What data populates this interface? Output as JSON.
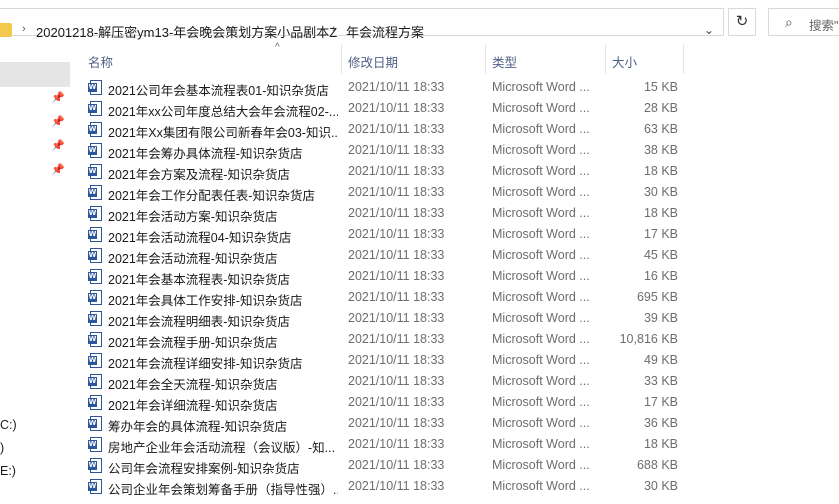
{
  "addressbar": {
    "path": [
      {
        "label": "20201218-解压密ym13-年会晚会策划方案小品剧本Z"
      },
      {
        "label": "年会流程方案"
      }
    ],
    "search_placeholder": "搜索\"年"
  },
  "navpane": {
    "drives": [
      "C:)",
      ")",
      "E:)"
    ]
  },
  "columns": {
    "name": "名称",
    "date": "修改日期",
    "type": "类型",
    "size": "大小"
  },
  "files": [
    {
      "name": "2021公司年会基本流程表01-知识杂货店",
      "date": "2021/10/11 18:33",
      "type": "Microsoft Word ...",
      "size": "15 KB"
    },
    {
      "name": "2021年xx公司年度总结大会年会流程02-...",
      "date": "2021/10/11 18:33",
      "type": "Microsoft Word ...",
      "size": "28 KB"
    },
    {
      "name": "2021年Xx集团有限公司新春年会03-知识...",
      "date": "2021/10/11 18:33",
      "type": "Microsoft Word ...",
      "size": "63 KB"
    },
    {
      "name": "2021年会筹办具体流程-知识杂货店",
      "date": "2021/10/11 18:33",
      "type": "Microsoft Word ...",
      "size": "38 KB"
    },
    {
      "name": "2021年会方案及流程-知识杂货店",
      "date": "2021/10/11 18:33",
      "type": "Microsoft Word ...",
      "size": "18 KB"
    },
    {
      "name": "2021年会工作分配表任表-知识杂货店",
      "date": "2021/10/11 18:33",
      "type": "Microsoft Word ...",
      "size": "30 KB"
    },
    {
      "name": "2021年会活动方案-知识杂货店",
      "date": "2021/10/11 18:33",
      "type": "Microsoft Word ...",
      "size": "18 KB"
    },
    {
      "name": "2021年会活动流程04-知识杂货店",
      "date": "2021/10/11 18:33",
      "type": "Microsoft Word ...",
      "size": "17 KB"
    },
    {
      "name": "2021年会活动流程-知识杂货店",
      "date": "2021/10/11 18:33",
      "type": "Microsoft Word ...",
      "size": "45 KB"
    },
    {
      "name": "2021年会基本流程表-知识杂货店",
      "date": "2021/10/11 18:33",
      "type": "Microsoft Word ...",
      "size": "16 KB"
    },
    {
      "name": "2021年会具体工作安排-知识杂货店",
      "date": "2021/10/11 18:33",
      "type": "Microsoft Word ...",
      "size": "695 KB"
    },
    {
      "name": "2021年会流程明细表-知识杂货店",
      "date": "2021/10/11 18:33",
      "type": "Microsoft Word ...",
      "size": "39 KB"
    },
    {
      "name": "2021年会流程手册-知识杂货店",
      "date": "2021/10/11 18:33",
      "type": "Microsoft Word ...",
      "size": "10,816 KB"
    },
    {
      "name": "2021年会流程详细安排-知识杂货店",
      "date": "2021/10/11 18:33",
      "type": "Microsoft Word ...",
      "size": "49 KB"
    },
    {
      "name": "2021年会全天流程-知识杂货店",
      "date": "2021/10/11 18:33",
      "type": "Microsoft Word ...",
      "size": "33 KB"
    },
    {
      "name": "2021年会详细流程-知识杂货店",
      "date": "2021/10/11 18:33",
      "type": "Microsoft Word ...",
      "size": "17 KB"
    },
    {
      "name": "筹办年会的具体流程-知识杂货店",
      "date": "2021/10/11 18:33",
      "type": "Microsoft Word ...",
      "size": "36 KB"
    },
    {
      "name": "房地产企业年会活动流程（会议版）-知...",
      "date": "2021/10/11 18:33",
      "type": "Microsoft Word ...",
      "size": "18 KB"
    },
    {
      "name": "公司年会流程安排案例-知识杂货店",
      "date": "2021/10/11 18:33",
      "type": "Microsoft Word ...",
      "size": "688 KB"
    },
    {
      "name": "公司企业年会策划筹备手册（指导性强）...",
      "date": "2021/10/11 18:33",
      "type": "Microsoft Word ...",
      "size": "30 KB"
    }
  ],
  "colors": {
    "word_blue": "#2b579a",
    "header_text": "#4d6185",
    "selection": "#e5e5e5"
  },
  "icons": {
    "file": "word-document-icon",
    "pin": "pin-icon",
    "refresh": "refresh-icon",
    "search": "search-icon"
  }
}
